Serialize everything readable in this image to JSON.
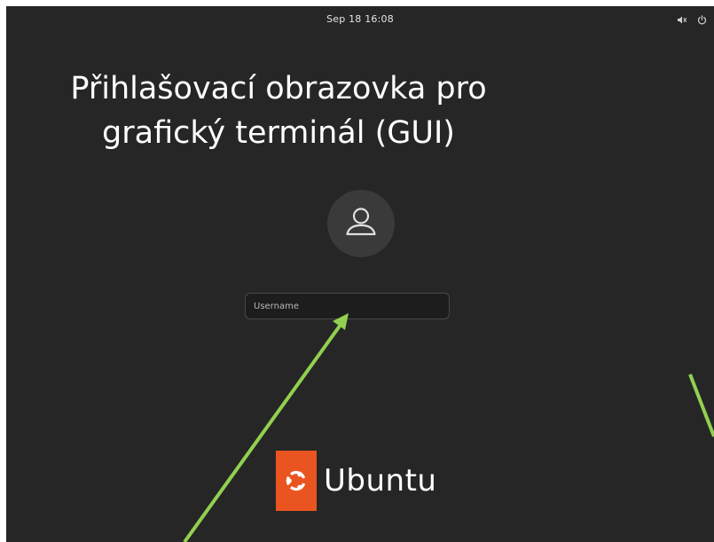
{
  "topbar": {
    "clock": "Sep 18  16:08",
    "icons": [
      "volume-muted-icon",
      "power-icon"
    ]
  },
  "annotation": {
    "title_line1": "Přihlašovací obrazovka pro",
    "title_line2": "grafický terminál (GUI)",
    "arrow_color": "#92d050"
  },
  "login": {
    "avatar_icon": "user-icon",
    "username_placeholder": "Username",
    "username_value": ""
  },
  "branding": {
    "logo_text": "Ubuntu",
    "logo_icon": "ubuntu-circle-of-friends-icon",
    "brand_color": "#e95420"
  },
  "colors": {
    "background": "#262626",
    "frame": "#ffffff"
  }
}
